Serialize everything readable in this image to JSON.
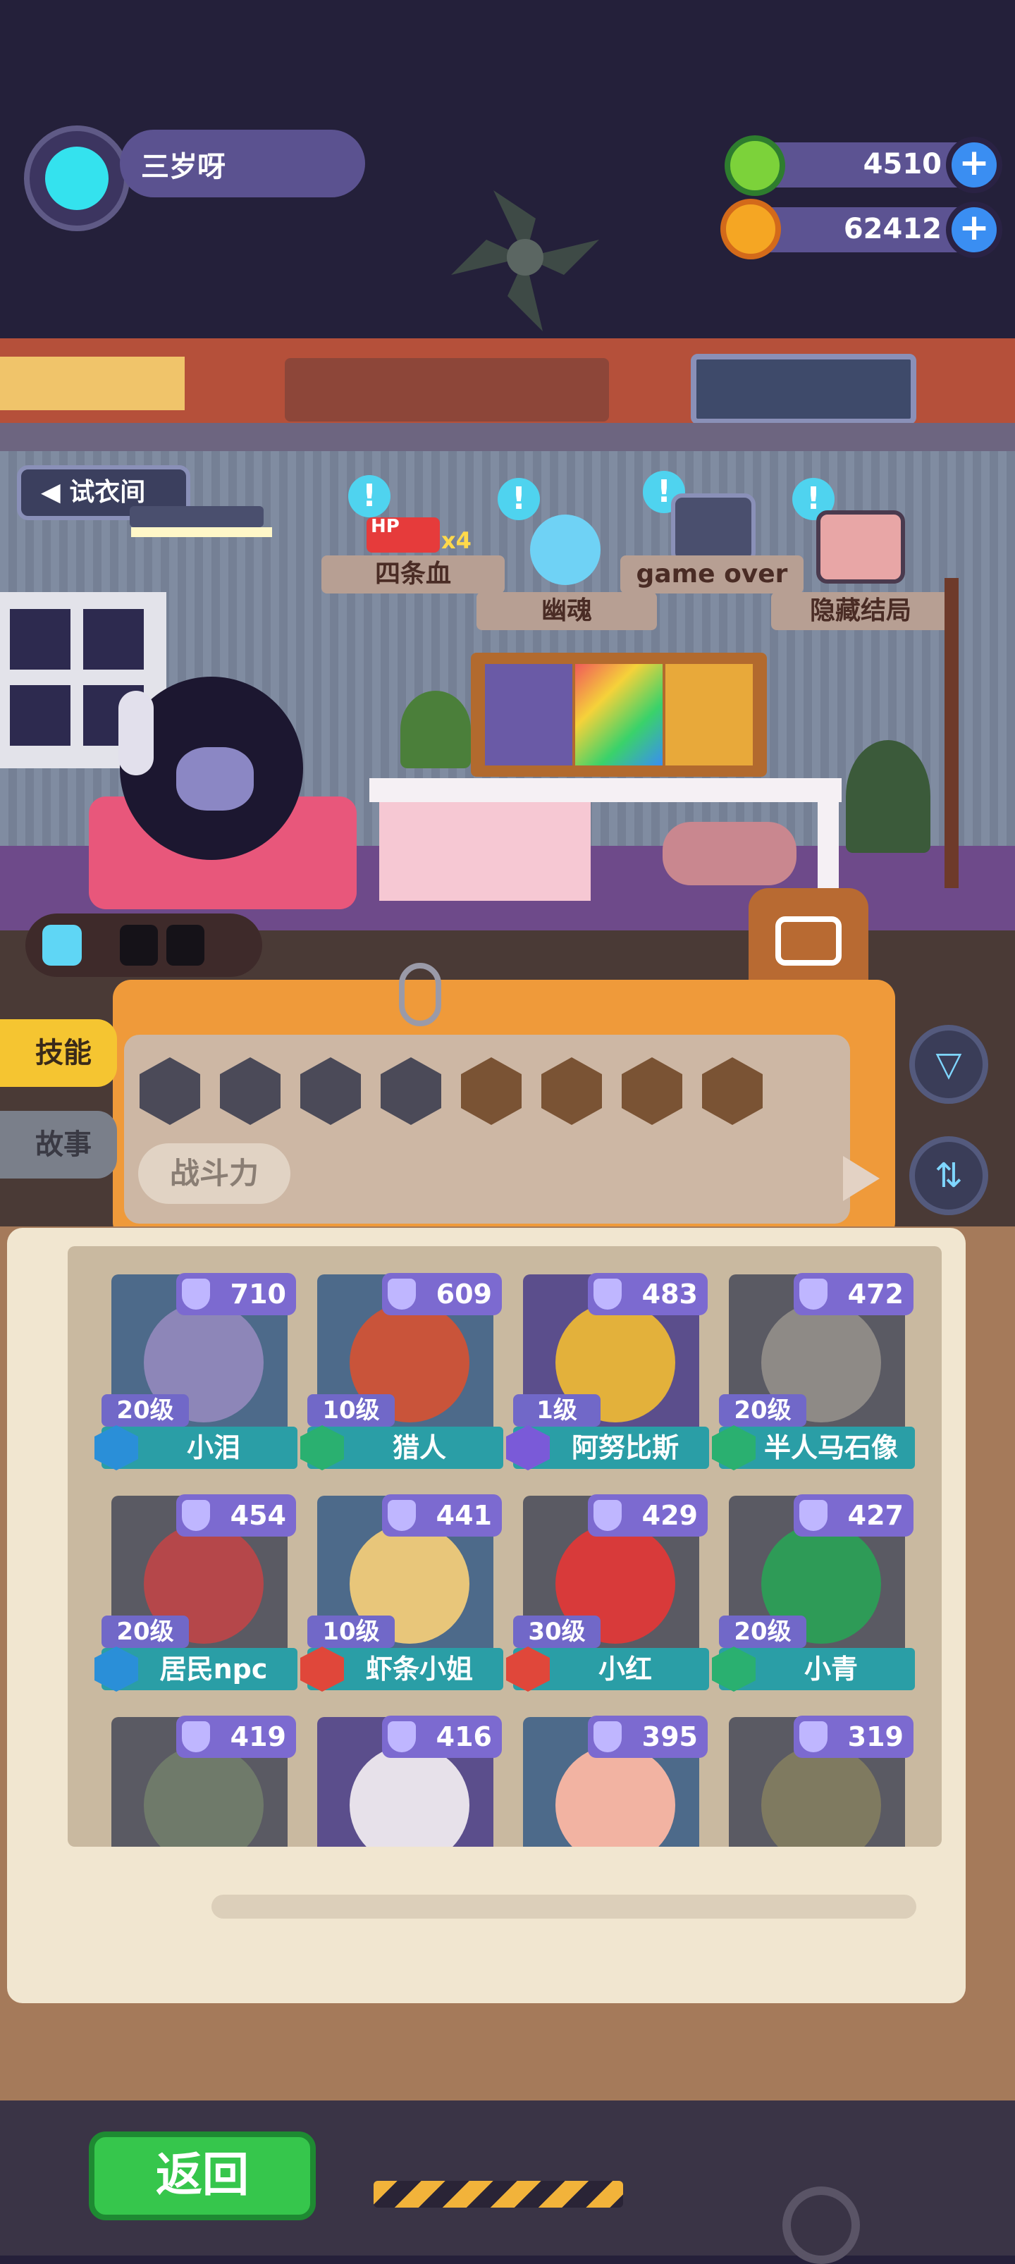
{
  "player": {
    "name": "三岁呀"
  },
  "currency": {
    "green": {
      "value": "4510",
      "icon": "green-donut-icon",
      "plus": "+"
    },
    "gold": {
      "value": "62412",
      "icon": "planet-coin-icon",
      "plus": "+"
    }
  },
  "room": {
    "fitting_room_label": "试衣间",
    "hp_count": "x4",
    "hp_label": "HP",
    "endings": [
      "四条血",
      "幽魂",
      "game over",
      "隐藏结局"
    ],
    "alert_mark": "!"
  },
  "filter": {
    "tabs": {
      "skill": "技能",
      "story": "故事"
    },
    "power_sort_label": "战斗力",
    "filter_icon": "funnel-icon",
    "sort_icon": "swap-icon"
  },
  "roster": [
    {
      "name": "小泪",
      "level": "20级",
      "power": "710",
      "class_color": "#2a8fd8",
      "bg": "#4d6a8a",
      "portrait": "#8d86b8"
    },
    {
      "name": "猎人",
      "level": "10级",
      "power": "609",
      "class_color": "#2ab070",
      "bg": "#4d6a8a",
      "portrait": "#c9543a"
    },
    {
      "name": "阿努比斯",
      "level": "1级",
      "power": "483",
      "class_color": "#7a5ad8",
      "bg": "#5b4e8c",
      "portrait": "#e3b13b"
    },
    {
      "name": "半人马石像",
      "level": "20级",
      "power": "472",
      "class_color": "#2ab070",
      "bg": "#5a5a63",
      "portrait": "#8e8a86"
    },
    {
      "name": "居民npc",
      "level": "20级",
      "power": "454",
      "class_color": "#2a8fd8",
      "bg": "#5a5a63",
      "portrait": "#b5474a"
    },
    {
      "name": "虾条小姐",
      "level": "10级",
      "power": "441",
      "class_color": "#e0473a",
      "bg": "#4d6a8a",
      "portrait": "#e8c67a"
    },
    {
      "name": "小红",
      "level": "30级",
      "power": "429",
      "class_color": "#e0473a",
      "bg": "#5a5a63",
      "portrait": "#d83a3a"
    },
    {
      "name": "小青",
      "level": "20级",
      "power": "427",
      "class_color": "#2ab070",
      "bg": "#5a5a63",
      "portrait": "#2e9b57"
    },
    {
      "name": "",
      "level": "",
      "power": "419",
      "class_color": "#2a8fd8",
      "bg": "#5a5a63",
      "portrait": "#6f7a6a"
    },
    {
      "name": "",
      "level": "",
      "power": "416",
      "class_color": "#2a8fd8",
      "bg": "#5b4e8c",
      "portrait": "#e7e1ea"
    },
    {
      "name": "",
      "level": "",
      "power": "395",
      "class_color": "#2a8fd8",
      "bg": "#4d6a8a",
      "portrait": "#f2b3a2"
    },
    {
      "name": "",
      "level": "",
      "power": "319",
      "class_color": "#2a8fd8",
      "bg": "#5a5a63",
      "portrait": "#7f7a60"
    }
  ],
  "footer": {
    "back_label": "返回"
  }
}
